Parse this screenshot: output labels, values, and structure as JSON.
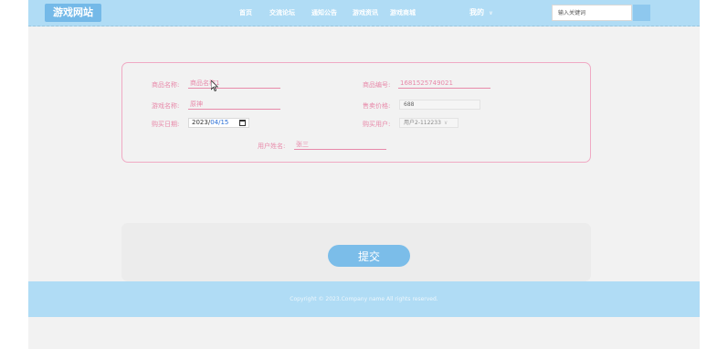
{
  "header": {
    "logo_text": "游戏网站",
    "nav": [
      {
        "label": "首页"
      },
      {
        "label": "交流论坛"
      },
      {
        "label": "通知公告"
      },
      {
        "label": "游戏资讯"
      },
      {
        "label": "游戏商城"
      }
    ],
    "user_menu_label": "我的",
    "user_menu_caret": "∨",
    "search": {
      "placeholder": "输入关键词"
    }
  },
  "form": {
    "product_name": {
      "label": "商品名称:",
      "value": "",
      "placeholder": "商品名称1"
    },
    "product_code": {
      "label": "商品编号:",
      "value": "1681525749021"
    },
    "game_name": {
      "label": "游戏名称:",
      "value": "原神"
    },
    "price": {
      "label": "售卖价格:",
      "value": "688"
    },
    "purchase_date": {
      "label": "购买日期:",
      "year": "2023/",
      "month_day": "04/15"
    },
    "buyer": {
      "label": "购买用户:",
      "value": "用户2-112233",
      "caret": "∨"
    },
    "user_name": {
      "label": "用户姓名:",
      "value": "张三"
    }
  },
  "submit_label": "提交",
  "footer": {
    "copyright": "Copyright © 2023.Company name All rights reserved."
  },
  "colors": {
    "nav_bg": "#b0dcf5",
    "accent": "#7bbde9",
    "label_pink": "#e88aaa",
    "page_bg": "#f2f2f2"
  }
}
